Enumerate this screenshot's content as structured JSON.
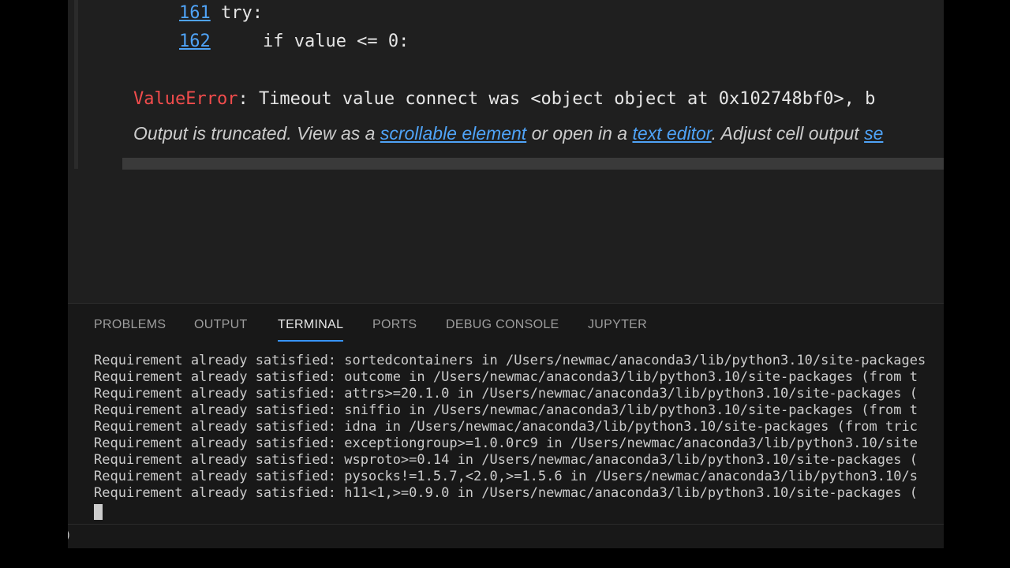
{
  "editor": {
    "code_lines": [
      {
        "number": "161",
        "code": "try:"
      },
      {
        "number": "162",
        "code": "    if value <= 0:"
      }
    ],
    "error": {
      "name": "ValueError",
      "message": ": Timeout value connect was <object object at 0x102748bf0>, b"
    },
    "truncation": {
      "text_before": "Output is truncated. View as a ",
      "link_scrollable": "scrollable element",
      "text_middle": " or open in a ",
      "link_text_editor": "text editor",
      "text_after": ". Adjust cell output ",
      "link_settings": "se"
    }
  },
  "panel": {
    "tabs": [
      {
        "label": "PROBLEMS",
        "active": false
      },
      {
        "label": "OUTPUT",
        "active": false
      },
      {
        "label": "TERMINAL",
        "active": true
      },
      {
        "label": "PORTS",
        "active": false
      },
      {
        "label": "DEBUG CONSOLE",
        "active": false
      },
      {
        "label": "JUPYTER",
        "active": false
      }
    ],
    "terminal_lines": [
      "Requirement already satisfied: sortedcontainers in /Users/newmac/anaconda3/lib/python3.10/site-packages",
      "Requirement already satisfied: outcome in /Users/newmac/anaconda3/lib/python3.10/site-packages (from t",
      "Requirement already satisfied: attrs>=20.1.0 in /Users/newmac/anaconda3/lib/python3.10/site-packages (",
      "Requirement already satisfied: sniffio in /Users/newmac/anaconda3/lib/python3.10/site-packages (from t",
      "Requirement already satisfied: idna in /Users/newmac/anaconda3/lib/python3.10/site-packages (from tric",
      "Requirement already satisfied: exceptiongroup>=1.0.0rc9 in /Users/newmac/anaconda3/lib/python3.10/site",
      "Requirement already satisfied: wsproto>=0.14 in /Users/newmac/anaconda3/lib/python3.10/site-packages (",
      "Requirement already satisfied: pysocks!=1.5.7,<2.0,>=1.5.6 in /Users/newmac/anaconda3/lib/python3.10/s",
      "Requirement already satisfied: h11<1,>=0.9.0 in /Users/newmac/anaconda3/lib/python3.10/site-packages ("
    ]
  },
  "statusbar": {
    "glyph": ")"
  },
  "colors": {
    "background": "#1f1f1f",
    "panel_background": "#181818",
    "error_name": "#f14c4c",
    "link": "#4fa3f7",
    "active_tab_underline": "#3794ff"
  }
}
